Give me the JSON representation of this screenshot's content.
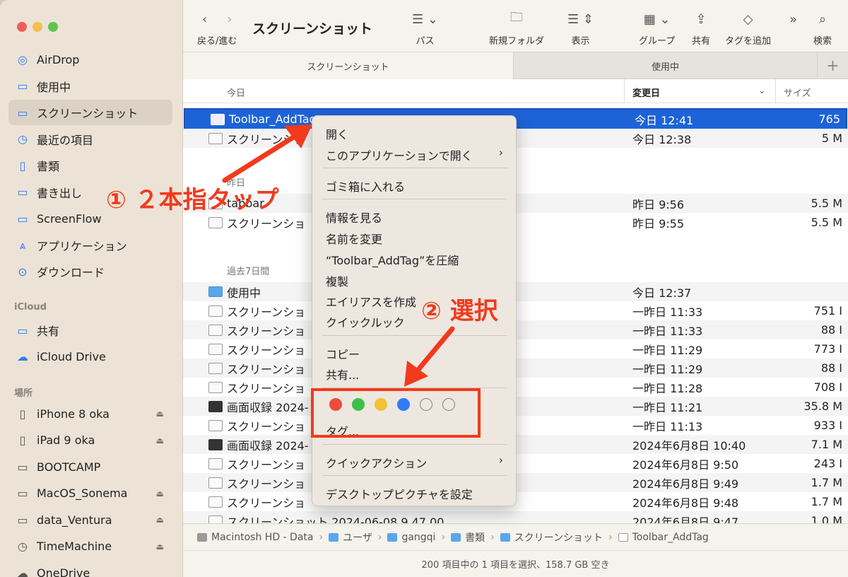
{
  "colors": {
    "accent": "#1d63d8",
    "annotation": "#f23a1d",
    "sidebar_bg": "#ece3d6"
  },
  "window": {
    "title": "スクリーンショット"
  },
  "toolbar": {
    "back_forward": "戻る/進む",
    "path": "パス",
    "new_folder": "新規フォルダ",
    "view": "表示",
    "group": "グループ",
    "share": "共有",
    "add_tag": "タグを追加",
    "search": "検索"
  },
  "tabs": [
    {
      "label": "スクリーンショット",
      "active": true
    },
    {
      "label": "使用中",
      "active": false
    }
  ],
  "sidebar": {
    "items": [
      {
        "label": "AirDrop",
        "icon": "airdrop-icon"
      },
      {
        "label": "使用中",
        "icon": "folder-icon"
      },
      {
        "label": "スクリーンショット",
        "icon": "folder-icon",
        "active": true
      },
      {
        "label": "最近の項目",
        "icon": "clock-icon"
      },
      {
        "label": "書類",
        "icon": "document-icon"
      },
      {
        "label": "書き出し",
        "icon": "folder-icon"
      },
      {
        "label": "ScreenFlow",
        "icon": "folder-icon"
      },
      {
        "label": "アプリケーション",
        "icon": "applications-icon"
      },
      {
        "label": "ダウンロード",
        "icon": "download-icon"
      }
    ],
    "icloud_section": "iCloud",
    "icloud_items": [
      {
        "label": "共有",
        "icon": "shared-folder-icon"
      },
      {
        "label": "iCloud Drive",
        "icon": "cloud-icon"
      }
    ],
    "locations_section": "場所",
    "locations": [
      {
        "label": "iPhone 8 oka",
        "icon": "iphone-icon",
        "eject": true
      },
      {
        "label": "iPad 9 oka",
        "icon": "ipad-icon",
        "eject": true
      },
      {
        "label": "BOOTCAMP",
        "icon": "disk-icon",
        "eject": false
      },
      {
        "label": "MacOS_Sonema",
        "icon": "disk-icon",
        "eject": true
      },
      {
        "label": "data_Ventura",
        "icon": "disk-icon",
        "eject": true
      },
      {
        "label": "TimeMachine",
        "icon": "timemachine-icon",
        "eject": true
      },
      {
        "label": "OneDrive",
        "icon": "cloud-icon",
        "eject": false
      }
    ]
  },
  "list_header": {
    "group": "今日",
    "date": "変更日",
    "size": "サイズ"
  },
  "groups": {
    "yesterday": "昨日",
    "past7": "過去7日間"
  },
  "files_today": [
    {
      "name": "Toolbar_AddTag",
      "date": "今日 12:41",
      "size": "765",
      "selected": true,
      "kind": "image"
    },
    {
      "name": "スクリーンショ",
      "date": "今日 12:38",
      "size": "5 M",
      "kind": "image"
    }
  ],
  "files_yesterday": [
    {
      "name": "tabbar",
      "date": "昨日 9:56",
      "size": "5.5 M",
      "kind": "image"
    },
    {
      "name": "スクリーンショ",
      "date": "昨日 9:55",
      "size": "5.5 M",
      "kind": "image"
    }
  ],
  "files_past7": [
    {
      "name": "使用中",
      "date": "今日 12:37",
      "size": "",
      "kind": "folder"
    },
    {
      "name": "スクリーンショ",
      "date": "一昨日 11:33",
      "size": "751 I",
      "kind": "image"
    },
    {
      "name": "スクリーンショ",
      "date": "一昨日 11:33",
      "size": "88 I",
      "kind": "image"
    },
    {
      "name": "スクリーンショ",
      "date": "一昨日 11:29",
      "size": "773 I",
      "kind": "image"
    },
    {
      "name": "スクリーンショ",
      "date": "一昨日 11:29",
      "size": "88 I",
      "kind": "image"
    },
    {
      "name": "スクリーンショ",
      "date": "一昨日 11:28",
      "size": "708 I",
      "kind": "image"
    },
    {
      "name": "画面収録 2024-",
      "date": "一昨日 11:21",
      "size": "35.8 M",
      "kind": "video"
    },
    {
      "name": "スクリーンショ",
      "date": "一昨日 11:13",
      "size": "933 I",
      "kind": "image"
    },
    {
      "name": "画面収録 2024-",
      "date": "2024年6月8日 10:40",
      "size": "7.1 M",
      "kind": "video"
    },
    {
      "name": "スクリーンショ",
      "date": "2024年6月8日 9:50",
      "size": "243 I",
      "kind": "image"
    },
    {
      "name": "スクリーンショ",
      "date": "2024年6月8日 9:49",
      "size": "1.7 M",
      "kind": "image"
    },
    {
      "name": "スクリーンショ",
      "date": "2024年6月8日 9:48",
      "size": "1.7 M",
      "kind": "image"
    },
    {
      "name": "スクリーンショット 2024-06-08 9.47.00",
      "date": "2024年6月8日 9:47",
      "size": "1.0 M",
      "kind": "image"
    }
  ],
  "pathbar": [
    "Macintosh HD - Data",
    "ユーザ",
    "gangqi",
    "書類",
    "スクリーンショット",
    "Toolbar_AddTag"
  ],
  "status": "200 項目中の 1 項目を選択、158.7 GB 空き",
  "context_menu": {
    "open": "開く",
    "open_with": "このアプリケーションで開く",
    "trash": "ゴミ箱に入れる",
    "get_info": "情報を見る",
    "rename": "名前を変更",
    "compress": "“Toolbar_AddTag”を圧縮",
    "duplicate": "複製",
    "make_alias": "エイリアスを作成",
    "quick_look": "クイックルック",
    "copy": "コピー",
    "share": "共有...",
    "tag_colors": [
      "#ee4b3d",
      "#3fbf4a",
      "#f1c232",
      "#2f7cf6",
      "none",
      "none"
    ],
    "tags": "タグ...",
    "quick_actions": "クイックアクション",
    "set_desktop": "デスクトップピクチャを設定"
  },
  "annotations": {
    "step1": "① ２本指タップ",
    "step2": "② 選択"
  }
}
